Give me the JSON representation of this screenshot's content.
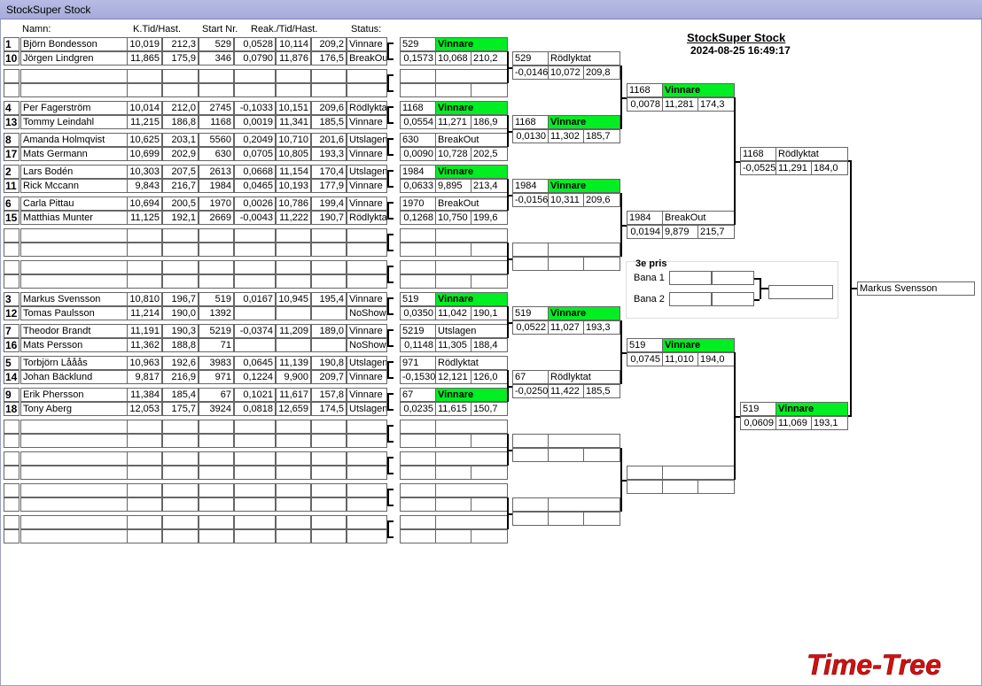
{
  "window": {
    "title": "StockSuper Stock"
  },
  "headers": {
    "name": "Namn:",
    "kt": "K.Tid/Hast.",
    "start": "Start Nr.",
    "reak": "Reak./Tid/Hast.",
    "status": "Status:"
  },
  "event": {
    "title": "StockSuper Stock",
    "time": "2024-08-25 16:49:17"
  },
  "colors": {
    "accent_win": "#00ee22",
    "titlebar": "#a6abd9",
    "brand_red": "#d21010"
  },
  "round1": [
    {
      "seed": "1",
      "name": "Björn Bondesson",
      "kt": "10,019",
      "hast": "212,3",
      "start": "529",
      "reak": "0,0528",
      "tid": "10,114",
      "hast2": "209,2",
      "status": "Vinnare"
    },
    {
      "seed": "10",
      "name": "Jörgen Lindgren",
      "kt": "11,865",
      "hast": "175,9",
      "start": "346",
      "reak": "0,0790",
      "tid": "11,876",
      "hast2": "176,5",
      "status": "BreakOut"
    },
    {
      "seed": "",
      "name": "",
      "kt": "",
      "hast": "",
      "start": "",
      "reak": "",
      "tid": "",
      "hast2": "",
      "status": ""
    },
    {
      "seed": "",
      "name": "",
      "kt": "",
      "hast": "",
      "start": "",
      "reak": "",
      "tid": "",
      "hast2": "",
      "status": ""
    },
    {
      "seed": "4",
      "name": "Per  Fagerström",
      "kt": "10,014",
      "hast": "212,0",
      "start": "2745",
      "reak": "-0,1033",
      "tid": "10,151",
      "hast2": "209,6",
      "status": "Rödlyktat"
    },
    {
      "seed": "13",
      "name": "Tommy  Leindahl",
      "kt": "11,215",
      "hast": "186,8",
      "start": "1168",
      "reak": "0,0019",
      "tid": "11,341",
      "hast2": "185,5",
      "status": "Vinnare"
    },
    {
      "seed": "8",
      "name": "Amanda Holmqvist",
      "kt": "10,625",
      "hast": "203,1",
      "start": "5560",
      "reak": "0,2049",
      "tid": "10,710",
      "hast2": "201,6",
      "status": "Utslagen"
    },
    {
      "seed": "17",
      "name": "Mats Germann",
      "kt": "10,699",
      "hast": "202,9",
      "start": "630",
      "reak": "0,0705",
      "tid": "10,805",
      "hast2": "193,3",
      "status": "Vinnare"
    },
    {
      "seed": "2",
      "name": "Lars Bodén",
      "kt": "10,303",
      "hast": "207,5",
      "start": "2613",
      "reak": "0,0668",
      "tid": "11,154",
      "hast2": "170,4",
      "status": "Utslagen"
    },
    {
      "seed": "11",
      "name": "Rick Mccann",
      "kt": "9,843",
      "hast": "216,7",
      "start": "1984",
      "reak": "0,0465",
      "tid": "10,193",
      "hast2": "177,9",
      "status": "Vinnare"
    },
    {
      "seed": "6",
      "name": "Carla Pittau",
      "kt": "10,694",
      "hast": "200,5",
      "start": "1970",
      "reak": "0,0026",
      "tid": "10,786",
      "hast2": "199,4",
      "status": "Vinnare"
    },
    {
      "seed": "15",
      "name": "Matthias Munter",
      "kt": "11,125",
      "hast": "192,1",
      "start": "2669",
      "reak": "-0,0043",
      "tid": "11,222",
      "hast2": "190,7",
      "status": "Rödlyktat"
    },
    {
      "seed": "",
      "name": "",
      "kt": "",
      "hast": "",
      "start": "",
      "reak": "",
      "tid": "",
      "hast2": "",
      "status": ""
    },
    {
      "seed": "",
      "name": "",
      "kt": "",
      "hast": "",
      "start": "",
      "reak": "",
      "tid": "",
      "hast2": "",
      "status": ""
    },
    {
      "seed": "",
      "name": "",
      "kt": "",
      "hast": "",
      "start": "",
      "reak": "",
      "tid": "",
      "hast2": "",
      "status": ""
    },
    {
      "seed": "",
      "name": "",
      "kt": "",
      "hast": "",
      "start": "",
      "reak": "",
      "tid": "",
      "hast2": "",
      "status": ""
    },
    {
      "seed": "3",
      "name": "Markus Svensson",
      "kt": "10,810",
      "hast": "196,7",
      "start": "519",
      "reak": "0,0167",
      "tid": "10,945",
      "hast2": "195,4",
      "status": "Vinnare"
    },
    {
      "seed": "12",
      "name": "Tomas Paulsson",
      "kt": "11,214",
      "hast": "190,0",
      "start": "1392",
      "reak": "",
      "tid": "",
      "hast2": "",
      "status": "NoShow"
    },
    {
      "seed": "7",
      "name": "Theodor Brandt",
      "kt": "11,191",
      "hast": "190,3",
      "start": "5219",
      "reak": "-0,0374",
      "tid": "11,209",
      "hast2": "189,0",
      "status": "Vinnare"
    },
    {
      "seed": "16",
      "name": "Mats Persson",
      "kt": "11,362",
      "hast": "188,8",
      "start": "71",
      "reak": "",
      "tid": "",
      "hast2": "",
      "status": "NoShow"
    },
    {
      "seed": "5",
      "name": "Torbjörn Lååås",
      "kt": "10,963",
      "hast": "192,6",
      "start": "3983",
      "reak": "0,0645",
      "tid": "11,139",
      "hast2": "190,8",
      "status": "Utslagen"
    },
    {
      "seed": "14",
      "name": "Johan Bäcklund",
      "kt": "9,817",
      "hast": "216,9",
      "start": "971",
      "reak": "0,1224",
      "tid": "9,900",
      "hast2": "209,7",
      "status": "Vinnare"
    },
    {
      "seed": "9",
      "name": "Erik Phersson",
      "kt": "11,384",
      "hast": "185,4",
      "start": "67",
      "reak": "0,1021",
      "tid": "11,617",
      "hast2": "157,8",
      "status": "Vinnare"
    },
    {
      "seed": "18",
      "name": "Tony Aberg",
      "kt": "12,053",
      "hast": "175,7",
      "start": "3924",
      "reak": "0,0818",
      "tid": "12,659",
      "hast2": "174,5",
      "status": "Utslagen"
    },
    {
      "seed": "",
      "name": "",
      "kt": "",
      "hast": "",
      "start": "",
      "reak": "",
      "tid": "",
      "hast2": "",
      "status": ""
    },
    {
      "seed": "",
      "name": "",
      "kt": "",
      "hast": "",
      "start": "",
      "reak": "",
      "tid": "",
      "hast2": "",
      "status": ""
    },
    {
      "seed": "",
      "name": "",
      "kt": "",
      "hast": "",
      "start": "",
      "reak": "",
      "tid": "",
      "hast2": "",
      "status": ""
    },
    {
      "seed": "",
      "name": "",
      "kt": "",
      "hast": "",
      "start": "",
      "reak": "",
      "tid": "",
      "hast2": "",
      "status": ""
    },
    {
      "seed": "",
      "name": "",
      "kt": "",
      "hast": "",
      "start": "",
      "reak": "",
      "tid": "",
      "hast2": "",
      "status": ""
    },
    {
      "seed": "",
      "name": "",
      "kt": "",
      "hast": "",
      "start": "",
      "reak": "",
      "tid": "",
      "hast2": "",
      "status": ""
    },
    {
      "seed": "",
      "name": "",
      "kt": "",
      "hast": "",
      "start": "",
      "reak": "",
      "tid": "",
      "hast2": "",
      "status": ""
    },
    {
      "seed": "",
      "name": "",
      "kt": "",
      "hast": "",
      "start": "",
      "reak": "",
      "tid": "",
      "hast2": "",
      "status": ""
    }
  ],
  "round2": [
    {
      "a": "529",
      "b": "Vinnare",
      "c": "0,1573",
      "d": "10,068",
      "e": "210,2",
      "win": true
    },
    {
      "a": "",
      "b": "",
      "c": "",
      "d": "",
      "e": "",
      "win": false
    },
    {
      "a": "1168",
      "b": "Vinnare",
      "c": "0,0554",
      "d": "11,271",
      "e": "186,9",
      "win": true
    },
    {
      "a": "630",
      "b": "BreakOut",
      "c": "0,0090",
      "d": "10,728",
      "e": "202,5",
      "win": false
    },
    {
      "a": "1984",
      "b": "Vinnare",
      "c": "0,0633",
      "d": "9,895",
      "e": "213,4",
      "win": true
    },
    {
      "a": "1970",
      "b": "BreakOut",
      "c": "0,1268",
      "d": "10,750",
      "e": "199,6",
      "win": false
    },
    {
      "a": "",
      "b": "",
      "c": "",
      "d": "",
      "e": "",
      "win": false
    },
    {
      "a": "",
      "b": "",
      "c": "",
      "d": "",
      "e": "",
      "win": false
    },
    {
      "a": "519",
      "b": "Vinnare",
      "c": "0,0350",
      "d": "11,042",
      "e": "190,1",
      "win": true
    },
    {
      "a": "5219",
      "b": "Utslagen",
      "c": "0,1148",
      "d": "11,305",
      "e": "188,4",
      "win": false
    },
    {
      "a": "971",
      "b": "Rödlyktat",
      "c": "-0,1530",
      "d": "12,121",
      "e": "126,0",
      "win": false
    },
    {
      "a": "67",
      "b": "Vinnare",
      "c": "0,0235",
      "d": "11,615",
      "e": "150,7",
      "win": true
    },
    {
      "a": "",
      "b": "",
      "c": "",
      "d": "",
      "e": "",
      "win": false
    },
    {
      "a": "",
      "b": "",
      "c": "",
      "d": "",
      "e": "",
      "win": false
    },
    {
      "a": "",
      "b": "",
      "c": "",
      "d": "",
      "e": "",
      "win": false
    },
    {
      "a": "",
      "b": "",
      "c": "",
      "d": "",
      "e": "",
      "win": false
    }
  ],
  "round3": [
    {
      "a": "529",
      "b": "Rödlyktat",
      "c": "-0,0146",
      "d": "10,072",
      "e": "209,8",
      "win": false
    },
    {
      "a": "1168",
      "b": "Vinnare",
      "c": "0,0130",
      "d": "11,302",
      "e": "185,7",
      "win": true
    },
    {
      "a": "1984",
      "b": "Vinnare",
      "c": "-0,0156",
      "d": "10,311",
      "e": "209,6",
      "win": true
    },
    {
      "a": "",
      "b": "",
      "c": "",
      "d": "",
      "e": "",
      "win": false
    },
    {
      "a": "519",
      "b": "Vinnare",
      "c": "0,0522",
      "d": "11,027",
      "e": "193,3",
      "win": true
    },
    {
      "a": "67",
      "b": "Rödlyktat",
      "c": "-0,0250",
      "d": "11,422",
      "e": "185,5",
      "win": false
    },
    {
      "a": "",
      "b": "",
      "c": "",
      "d": "",
      "e": "",
      "win": false
    },
    {
      "a": "",
      "b": "",
      "c": "",
      "d": "",
      "e": "",
      "win": false
    }
  ],
  "round4": [
    {
      "a": "1168",
      "b": "Vinnare",
      "c": "0,0078",
      "d": "11,281",
      "e": "174,3",
      "win": true
    },
    {
      "a": "1984",
      "b": "BreakOut",
      "c": "0,0194",
      "d": "9,879",
      "e": "215,7",
      "win": false
    },
    {
      "a": "519",
      "b": "Vinnare",
      "c": "0,0745",
      "d": "11,010",
      "e": "194,0",
      "win": true
    },
    {
      "a": "",
      "b": "",
      "c": "",
      "d": "",
      "e": "",
      "win": false
    }
  ],
  "round5": [
    {
      "a": "1168",
      "b": "Rödlyktat",
      "c": "-0,0525",
      "d": "11,291",
      "e": "184,0",
      "win": false
    },
    {
      "a": "519",
      "b": "Vinnare",
      "c": "0,0609",
      "d": "11,069",
      "e": "193,1",
      "win": true
    }
  ],
  "third": {
    "title": "3e pris",
    "bana1": "Bana 1",
    "bana2": "Bana 2"
  },
  "champion": "Markus Svensson",
  "brand": {
    "text": "Time-Tree"
  }
}
